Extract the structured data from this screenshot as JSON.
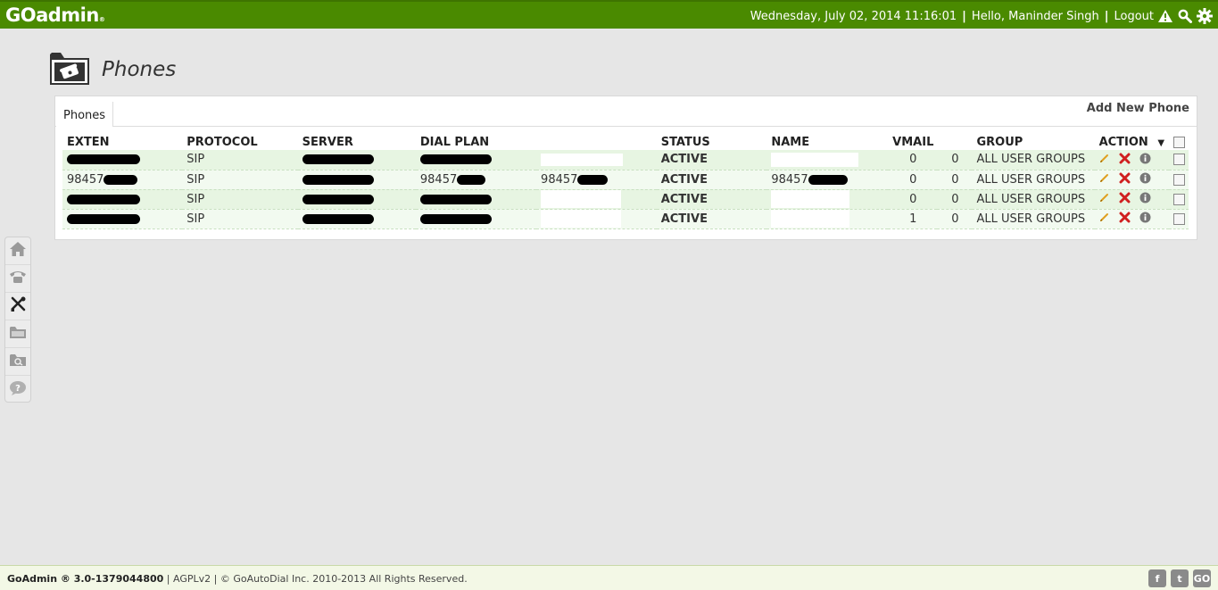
{
  "header": {
    "logo": "GOadmin",
    "datetime": "Wednesday, July 02, 2014 11:16:01",
    "greeting": "Hello, Maninder Singh",
    "logout": "Logout"
  },
  "page": {
    "title": "Phones"
  },
  "tabs": [
    {
      "label": "Phones"
    }
  ],
  "add_new": "Add New Phone",
  "columns": [
    "EXTEN",
    "PROTOCOL",
    "SERVER",
    "DIAL PLAN",
    "",
    "STATUS",
    "NAME",
    "VMAIL",
    "",
    "GROUP",
    "ACTION"
  ],
  "rows": [
    {
      "exten": "",
      "protocol": "SIP",
      "server": "",
      "dialplan": "",
      "extra": "",
      "status": "ACTIVE",
      "name": "",
      "vmail1": "0",
      "vmail2": "0",
      "group": "ALL USER GROUPS"
    },
    {
      "exten": "98457",
      "protocol": "SIP",
      "server": "",
      "dialplan": "98457",
      "extra": "98457",
      "status": "ACTIVE",
      "name": "98457",
      "vmail1": "0",
      "vmail2": "0",
      "group": "ALL USER GROUPS"
    },
    {
      "exten": "",
      "protocol": "SIP",
      "server": "",
      "dialplan": "",
      "extra": "",
      "status": "ACTIVE",
      "name": "",
      "vmail1": "0",
      "vmail2": "0",
      "group": "ALL USER GROUPS"
    },
    {
      "exten": "",
      "protocol": "SIP",
      "server": "",
      "dialplan": "",
      "extra": "",
      "status": "ACTIVE",
      "name": "",
      "vmail1": "1",
      "vmail2": "0",
      "group": "ALL USER GROUPS"
    }
  ],
  "footer": {
    "product": "GoAdmin ® 3.0-1379044800",
    "license": "AGPLv2",
    "copyright": "© GoAutoDial Inc. 2010-2013 All Rights Reserved.",
    "social": [
      "f",
      "t",
      "GO"
    ]
  },
  "colors": {
    "topbar": "#4a8a00",
    "status_active": "#2a8a00",
    "row_a": "#e7f5e2",
    "row_b": "#f2faf0"
  }
}
